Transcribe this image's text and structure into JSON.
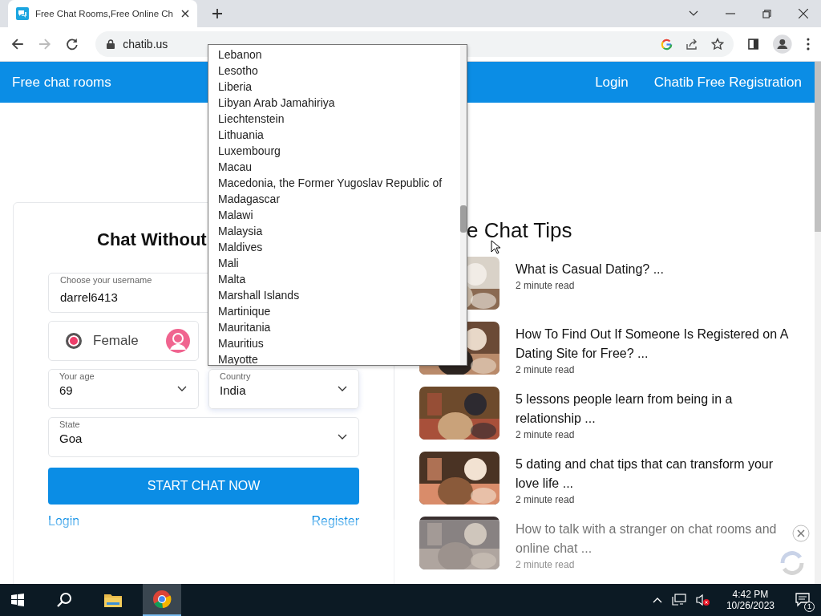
{
  "browser": {
    "tab": {
      "title": "Free Chat Rooms,Free Online Ch",
      "selected": true
    },
    "address": "chatib.us"
  },
  "navbar": {
    "brand": "Free chat rooms",
    "links": [
      "Login",
      "Chatib Free Registration"
    ]
  },
  "form": {
    "title": "Chat Without",
    "username": {
      "label": "Choose your username",
      "value": "darrel6413"
    },
    "gender": {
      "label": "Female",
      "selected": true
    },
    "age": {
      "label": "Your age",
      "value": "69"
    },
    "country": {
      "label": "Country",
      "value": "India"
    },
    "state": {
      "label": "State",
      "value": "Goa"
    },
    "submit": "START CHAT NOW",
    "links": [
      "Login",
      "Register"
    ]
  },
  "tips": {
    "title": "e Chat Tips",
    "articles": [
      {
        "title": "What is Casual Dating? ...",
        "meta": "2 minute read"
      },
      {
        "title": "How To Find Out If Someone Is Registered on A Dating Site for Free? ...",
        "meta": "2 minute read"
      },
      {
        "title": "5 lessons people learn from being in a relationship ...",
        "meta": "2 minute read"
      },
      {
        "title": "5 dating and chat tips that can transform your love life ...",
        "meta": "2 minute read"
      },
      {
        "title": "How to talk with a stranger on chat rooms and online chat ...",
        "meta": "2 minute read"
      }
    ]
  },
  "country_dropdown": {
    "options": [
      "Lebanon",
      "Lesotho",
      "Liberia",
      "Libyan Arab Jamahiriya",
      "Liechtenstein",
      "Lithuania",
      "Luxembourg",
      "Macau",
      "Macedonia, the Former Yugoslav Republic of",
      "Madagascar",
      "Malawi",
      "Malaysia",
      "Maldives",
      "Mali",
      "Malta",
      "Marshall Islands",
      "Martinique",
      "Mauritania",
      "Mauritius",
      "Mayotte"
    ]
  },
  "taskbar": {
    "time": "4:42 PM",
    "date": "10/26/2023",
    "notifications": "1"
  }
}
